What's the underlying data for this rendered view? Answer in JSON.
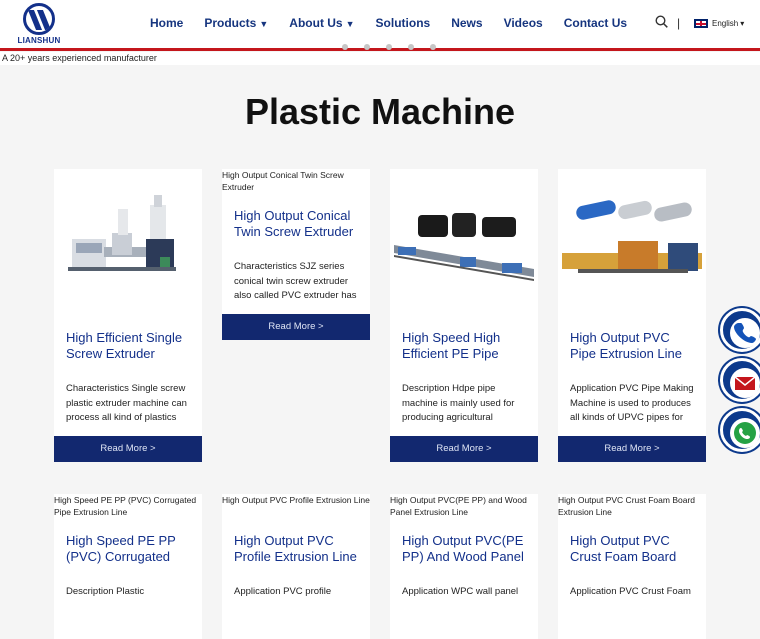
{
  "logo": {
    "text": "LIANSHUN"
  },
  "nav": {
    "items": [
      "Home",
      "Products",
      "About Us",
      "Solutions",
      "News",
      "Videos",
      "Contact Us"
    ],
    "dropdown_caret": "▼"
  },
  "header": {
    "separator": "|",
    "language": "English",
    "language_caret": "▾"
  },
  "hero": {
    "alt_text": "A 20+ years experienced manufacturer"
  },
  "page": {
    "title": "Plastic Machine"
  },
  "read_more": "Read More >",
  "products_row1": [
    {
      "title": "High Efficient Single Screw Extruder",
      "desc": "Characteristics Single screw plastic extruder machine can process all kind of plastics",
      "image": "single-screw-extruder"
    },
    {
      "alt": "High Output Conical Twin Screw Extruder",
      "title": "High Output Conical Twin Screw Extruder",
      "desc": "Characteristics SJZ series conical twin screw extruder also called PVC extruder has"
    },
    {
      "title": "High Speed High Efficient PE Pipe",
      "desc": "Description Hdpe pipe machine is mainly used for producing agricultural",
      "image": "pe-pipe-line"
    },
    {
      "title": "High Output PVC Pipe Extrusion Line",
      "desc": "Application PVC Pipe Making Machine is used to produces all kinds of UPVC pipes for",
      "image": "pvc-pipe-line"
    }
  ],
  "products_row2": [
    {
      "alt": "High Speed PE PP (PVC) Corrugated Pipe Extrusion Line",
      "title": "High Speed PE PP (PVC) Corrugated",
      "desc": "Description Plastic"
    },
    {
      "alt": "High Output PVC Profile Extrusion Line",
      "title": "High Output PVC Profile Extrusion Line",
      "desc": "Application PVC profile"
    },
    {
      "alt": "High Output PVC(PE PP) and Wood Panel Extrusion Line",
      "title": "High Output PVC(PE PP) And Wood Panel",
      "desc": "Application WPC wall panel"
    },
    {
      "alt": "High Output PVC Crust Foam Board Extrusion Line",
      "title": "High Output PVC Crust Foam Board",
      "desc": "Application PVC Crust Foam"
    }
  ],
  "floating": [
    "phone-icon",
    "email-icon",
    "whatsapp-icon"
  ],
  "colors": {
    "brand_blue": "#13308a",
    "button_navy": "#12286f",
    "accent_red": "#c4161c",
    "float_blue": "#0d3a8c"
  }
}
